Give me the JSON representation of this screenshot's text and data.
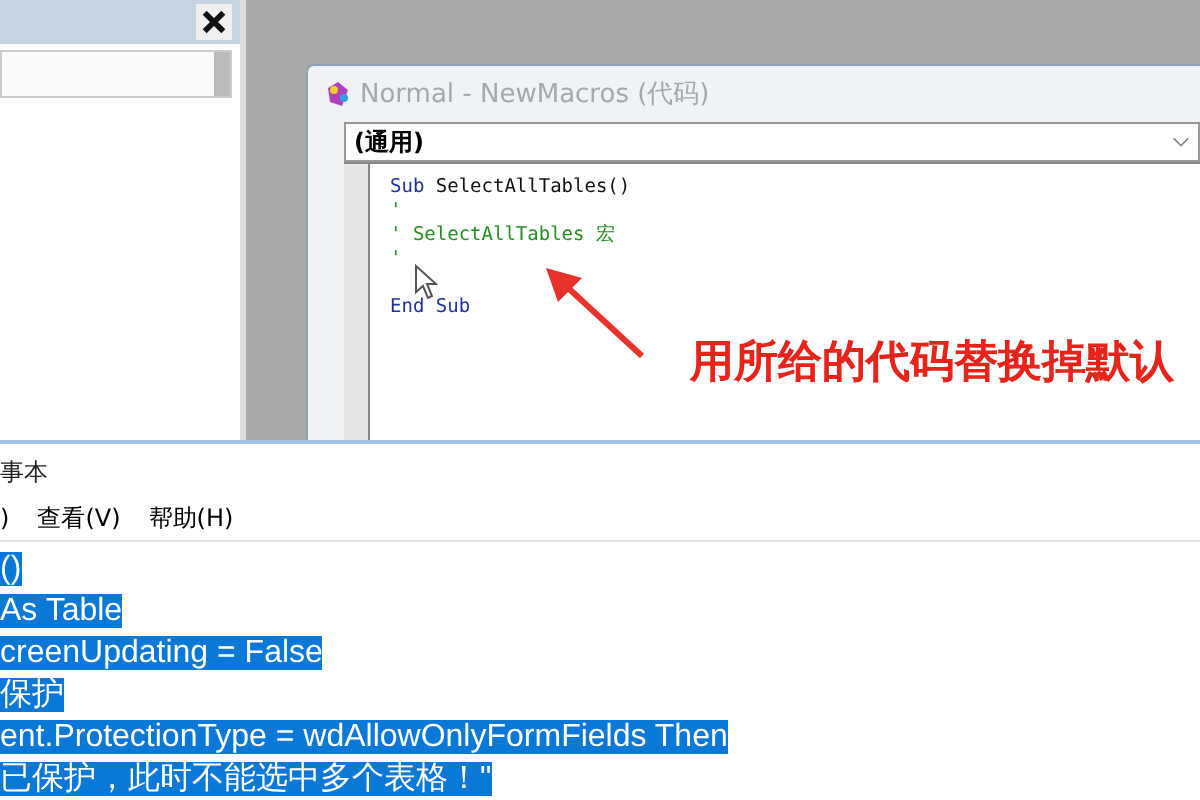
{
  "code_window": {
    "title": "Normal - NewMacros (代码)",
    "object_dropdown": "(通用)",
    "lines": [
      {
        "kind": "code",
        "segments": [
          {
            "kind": "keyword",
            "text": "Sub"
          },
          {
            "kind": "plain",
            "text": " SelectAllTables()"
          }
        ]
      },
      {
        "kind": "code",
        "segments": [
          {
            "kind": "comment",
            "text": "'"
          }
        ]
      },
      {
        "kind": "code",
        "segments": [
          {
            "kind": "comment",
            "text": "' SelectAllTables 宏"
          }
        ]
      },
      {
        "kind": "code",
        "segments": [
          {
            "kind": "comment",
            "text": "'"
          }
        ]
      },
      {
        "kind": "blank"
      },
      {
        "kind": "code",
        "segments": [
          {
            "kind": "keyword",
            "text": "End Sub"
          }
        ]
      }
    ]
  },
  "annotation": {
    "text": "用所给的代码替换掉默认"
  },
  "notepad": {
    "title": "事本",
    "menu": [
      ")",
      "查看(V)",
      "帮助(H)"
    ],
    "lines": [
      {
        "text": "()",
        "selected": true
      },
      {
        "text": "As Table",
        "selected": true
      },
      {
        "text": "creenUpdating = False",
        "selected": true
      },
      {
        "text": "保护",
        "selected": true
      },
      {
        "text": "ent.ProtectionType = wdAllowOnlyFormFields Then",
        "selected": true
      },
      {
        "text": "已保护，此时不能选中多个表格！\"",
        "selected": true
      }
    ]
  }
}
